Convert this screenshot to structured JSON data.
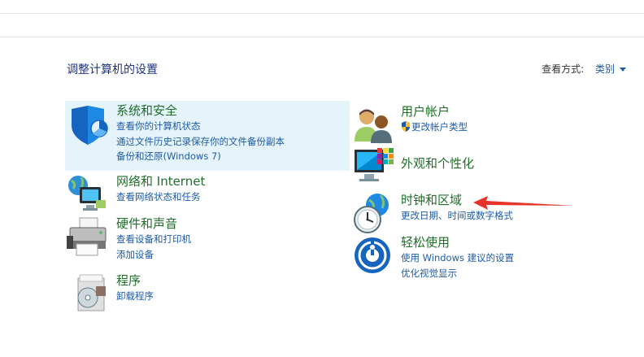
{
  "page": {
    "title": "调整计算机的设置"
  },
  "view_by": {
    "label": "查看方式:",
    "value": "类别"
  },
  "categories": [
    {
      "title": "系统和安全",
      "links": [
        "查看你的计算机状态",
        "通过文件历史记录保存你的文件备份副本",
        "备份和还原(Windows 7)"
      ],
      "icon": "shield-icon"
    },
    {
      "title": "网络和 Internet",
      "links": [
        "查看网络状态和任务"
      ],
      "icon": "network-globe-icon"
    },
    {
      "title": "硬件和声音",
      "links": [
        "查看设备和打印机",
        "添加设备"
      ],
      "icon": "printer-icon"
    },
    {
      "title": "程序",
      "links": [
        "卸载程序"
      ],
      "icon": "programs-disc-icon"
    },
    {
      "title": "用户帐户",
      "links": [
        "更改帐户类型"
      ],
      "icon": "users-icon"
    },
    {
      "title": "外观和个性化",
      "links": [],
      "icon": "monitor-palette-icon"
    },
    {
      "title": "时钟和区域",
      "links": [
        "更改日期、时间或数字格式"
      ],
      "icon": "clock-globe-icon"
    },
    {
      "title": "轻松使用",
      "links": [
        "使用 Windows 建议的设置",
        "优化视觉显示"
      ],
      "icon": "ease-of-access-icon"
    }
  ],
  "colors": {
    "title_green": "#1f6f29",
    "link_blue": "#1e5ba8",
    "selected_bg": "#e5f3fb",
    "arrow_red": "#e8332a"
  }
}
